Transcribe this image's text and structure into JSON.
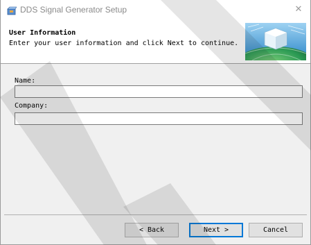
{
  "window": {
    "title": "DDS Signal Generator Setup",
    "close_glyph": "✕"
  },
  "header": {
    "title": "User Information",
    "subtitle": "Enter your user information and click Next to continue."
  },
  "form": {
    "name_label": "Name:",
    "name_value": "",
    "company_label": "Company:",
    "company_value": ""
  },
  "buttons": {
    "back": "< Back",
    "next": "Next >",
    "cancel": "Cancel"
  },
  "icons": {
    "app": "setup-box-icon",
    "header_graphic": "globe-cube-graphic"
  },
  "colors": {
    "accent": "#0078d7",
    "watermark": "#2a2a2a"
  }
}
